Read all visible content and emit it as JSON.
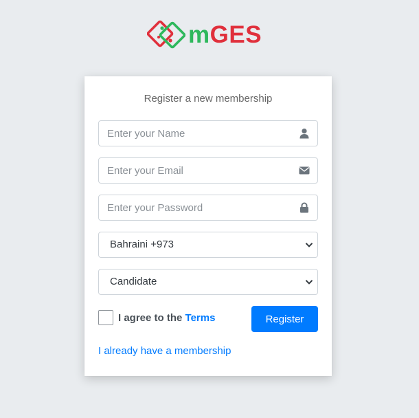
{
  "brand": {
    "logo_m": "m",
    "logo_ges": "GES",
    "colors": {
      "green": "#2eb85c",
      "red": "#e0303c"
    }
  },
  "form": {
    "title": "Register a new membership",
    "name_placeholder": "Enter your Name",
    "email_placeholder": "Enter your Email",
    "password_placeholder": "Enter your Password",
    "country_selected": "Bahraini +973",
    "role_selected": "Candidate",
    "agree_prefix": "I agree to the",
    "terms_label": "Terms",
    "register_label": "Register",
    "membership_link": "I already have a membership",
    "icons": {
      "name": "user-icon",
      "email": "envelope-icon",
      "password": "lock-icon",
      "select": "chevron-down-icon"
    },
    "accent_color": "#007bff"
  }
}
